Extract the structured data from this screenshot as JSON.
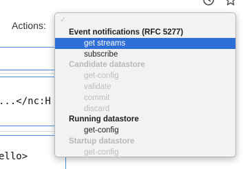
{
  "actions": {
    "label": "Actions:"
  },
  "background_text": {
    "line1": "...</nc:H",
    "line2": "ello>"
  },
  "dropdown": {
    "items": [
      {
        "type": "group",
        "label": "Event notifications (RFC 5277)",
        "disabled": false
      },
      {
        "type": "option",
        "label": "get streams",
        "disabled": false,
        "selected": true
      },
      {
        "type": "option",
        "label": "subscribe",
        "disabled": false,
        "selected": false
      },
      {
        "type": "group",
        "label": "Candidate datastore",
        "disabled": true
      },
      {
        "type": "option",
        "label": "get-config",
        "disabled": true,
        "selected": false
      },
      {
        "type": "option",
        "label": "validate",
        "disabled": true,
        "selected": false
      },
      {
        "type": "option",
        "label": "commit",
        "disabled": true,
        "selected": false
      },
      {
        "type": "option",
        "label": "discard",
        "disabled": true,
        "selected": false
      },
      {
        "type": "group",
        "label": "Running datastore",
        "disabled": false
      },
      {
        "type": "option",
        "label": "get-config",
        "disabled": false,
        "selected": false
      },
      {
        "type": "group",
        "label": "Startup datastore",
        "disabled": true
      },
      {
        "type": "option",
        "label": "get-config",
        "disabled": true,
        "selected": false
      }
    ]
  },
  "colors": {
    "selection": "#2f6fd8",
    "panel_border": "#4a90e2",
    "menu_background": "#f2f2f2"
  },
  "icons": [
    "history-icon",
    "bookmark-star-icon",
    "checkmark-icon"
  ]
}
